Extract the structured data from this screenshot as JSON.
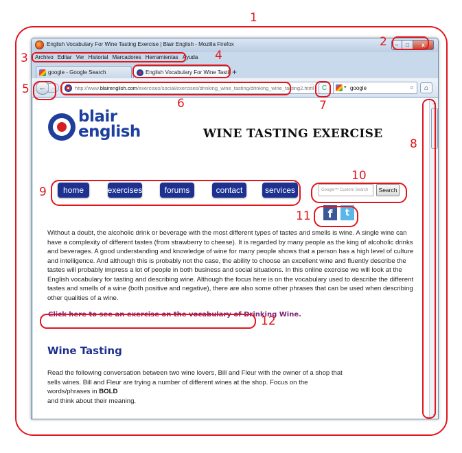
{
  "window": {
    "title": "English Vocabulary For Wine Tasting Exercise | Blair English - Mozilla Firefox",
    "controls": {
      "minimize": "–",
      "maximize": "□",
      "close": "x"
    }
  },
  "menubar": [
    "Archivo",
    "Editar",
    "Ver",
    "Historial",
    "Marcadores",
    "Herramientas",
    "Ayuda"
  ],
  "tabs": [
    {
      "label": "google - Google Search",
      "favicon": "google-favicon"
    },
    {
      "label": "English Vocabulary For Wine Tasting ...",
      "favicon": "blair-english-favicon",
      "active": true,
      "close": "×"
    }
  ],
  "toolbar": {
    "new_tab": "+",
    "back": "←",
    "forward": "→",
    "url_prefix": "http://www.",
    "url_domain": "blairenglish.com",
    "url_path": "/exercises/social/exercises/drinking_wine_tasting/drinking_wine_tasting2.html",
    "bookmark_star": "☆",
    "reload": "C",
    "search_engine_value": "google",
    "search_dropdown": "▾",
    "search_icon": "⌕",
    "home": "⌂"
  },
  "page": {
    "logo_line1": "blair",
    "logo_line2": "english",
    "heading": "WINE TASTING EXERCISE",
    "nav": [
      "home",
      "exercises",
      "forums",
      "contact",
      "services"
    ],
    "search_placeholder": "Google™ Custom Search",
    "search_button": "Search",
    "social": {
      "facebook": "f",
      "twitter": "t"
    },
    "intro": "Without a doubt, the alcoholic drink or beverage with the most different types of tastes and smells is wine. A single wine can have a complexity of different tastes (from strawberry to cheese). It is regarded by many people as the king of alcoholic drinks and beverages. A good understanding and knowledge of wine for many people shows that a person has a high level of culture and intelligence. And although this is probably not the case, the ability to choose an excellent wine and fluently describe the tastes will probably impress a lot of people in both business and social situations. In this online exercise we will look at the English vocabulary for tasting and describing wine. Although the focus here is on the vocabulary used to describe the different tastes and smells of a wine (both positive and negative), there are also some other phrases that can be used when describing other qualities of a wine.",
    "cta_link": "Click here to see an exercise on the vocabulary of Drinking Wine.",
    "section_title": "Wine Tasting",
    "conversation_intro": "Read the following conversation between two wine lovers, Bill and Fleur with the owner of a shop that sells wines. Bill and Fleur are trying a number of different wines at the shop. Focus on the words/phrases in",
    "conversation_bold": "BOLD",
    "conversation_end": "and think about their meaning."
  },
  "scrollbar": {
    "up": "▴",
    "down": "▾"
  },
  "annotations": [
    "1",
    "2",
    "3",
    "4",
    "5",
    "6",
    "7",
    "8",
    "9",
    "10",
    "11",
    "12"
  ],
  "colors": {
    "annotation_red": "#e0161d",
    "nav_button_blue": "#1d3190",
    "logo_blue": "#1d3fa0",
    "logo_red": "#d81e1e",
    "section_title_blue": "#1d2f8c",
    "link_purple": "#7a1f75",
    "facebook_blue": "#3b5998",
    "twitter_blue": "#5ab7e8"
  }
}
